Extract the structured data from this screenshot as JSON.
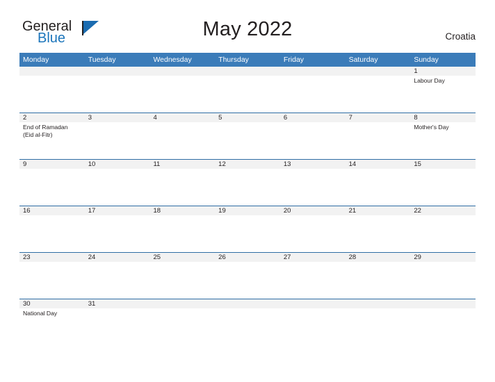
{
  "brand": {
    "name_part1": "General",
    "name_part2": "Blue",
    "flag_icon": "blue-triangle-flag-icon"
  },
  "header": {
    "title": "May 2022",
    "country": "Croatia"
  },
  "colors": {
    "header_blue": "#3b7cb9",
    "row_rule_blue": "#2e6da4",
    "date_band_gray": "#f2f2f2",
    "logo_blue": "#1b75bb",
    "text": "#231f20"
  },
  "calendar": {
    "weekdays": [
      "Monday",
      "Tuesday",
      "Wednesday",
      "Thursday",
      "Friday",
      "Saturday",
      "Sunday"
    ],
    "weeks": [
      {
        "days": [
          {
            "date": "",
            "events": []
          },
          {
            "date": "",
            "events": []
          },
          {
            "date": "",
            "events": []
          },
          {
            "date": "",
            "events": []
          },
          {
            "date": "",
            "events": []
          },
          {
            "date": "",
            "events": []
          },
          {
            "date": "1",
            "events": [
              "Labour Day"
            ]
          }
        ]
      },
      {
        "days": [
          {
            "date": "2",
            "events": [
              "End of Ramadan",
              "(Eid al-Fitr)"
            ]
          },
          {
            "date": "3",
            "events": []
          },
          {
            "date": "4",
            "events": []
          },
          {
            "date": "5",
            "events": []
          },
          {
            "date": "6",
            "events": []
          },
          {
            "date": "7",
            "events": []
          },
          {
            "date": "8",
            "events": [
              "Mother's Day"
            ]
          }
        ]
      },
      {
        "days": [
          {
            "date": "9",
            "events": []
          },
          {
            "date": "10",
            "events": []
          },
          {
            "date": "11",
            "events": []
          },
          {
            "date": "12",
            "events": []
          },
          {
            "date": "13",
            "events": []
          },
          {
            "date": "14",
            "events": []
          },
          {
            "date": "15",
            "events": []
          }
        ]
      },
      {
        "days": [
          {
            "date": "16",
            "events": []
          },
          {
            "date": "17",
            "events": []
          },
          {
            "date": "18",
            "events": []
          },
          {
            "date": "19",
            "events": []
          },
          {
            "date": "20",
            "events": []
          },
          {
            "date": "21",
            "events": []
          },
          {
            "date": "22",
            "events": []
          }
        ]
      },
      {
        "days": [
          {
            "date": "23",
            "events": []
          },
          {
            "date": "24",
            "events": []
          },
          {
            "date": "25",
            "events": []
          },
          {
            "date": "26",
            "events": []
          },
          {
            "date": "27",
            "events": []
          },
          {
            "date": "28",
            "events": []
          },
          {
            "date": "29",
            "events": []
          }
        ]
      },
      {
        "days": [
          {
            "date": "30",
            "events": [
              "National Day"
            ]
          },
          {
            "date": "31",
            "events": []
          },
          {
            "date": "",
            "events": []
          },
          {
            "date": "",
            "events": []
          },
          {
            "date": "",
            "events": []
          },
          {
            "date": "",
            "events": []
          },
          {
            "date": "",
            "events": []
          }
        ]
      }
    ]
  }
}
